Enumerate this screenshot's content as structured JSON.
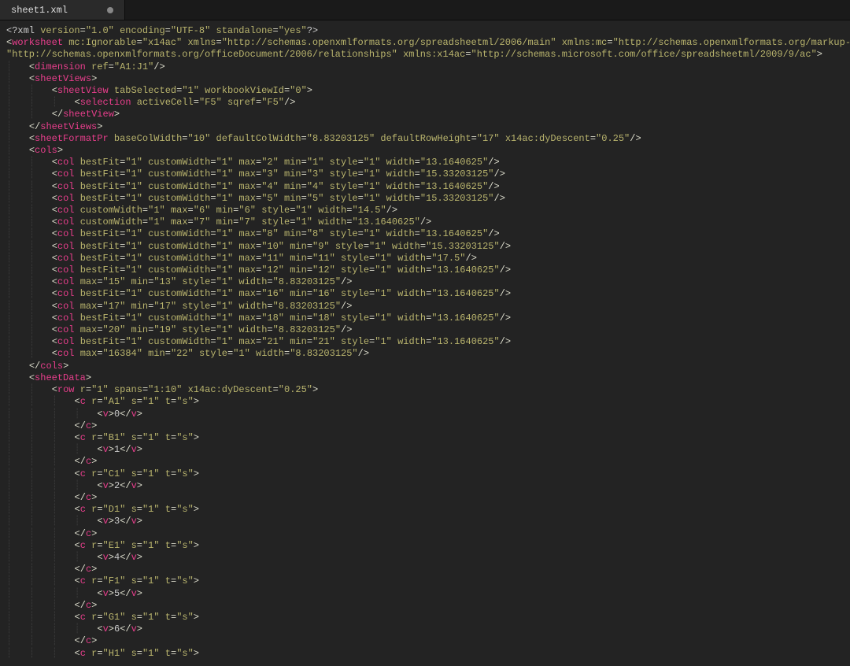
{
  "tab": {
    "filename": "sheet1.xml",
    "dirty": true
  },
  "xml_decl": {
    "version": "1.0",
    "encoding": "UTF-8",
    "standalone": "yes"
  },
  "worksheet": {
    "mc_Ignorable": "x14ac",
    "xmlns": "http://schemas.openxmlformats.org/spreadsheetml/2006/main",
    "xmlns_mc": "http://schemas.openxmlformats.org/markup-co",
    "xmlns_r_prefix": "\"http://schemas.openxmlformats.org/officeDocument/2006/relationships\"",
    "xmlns_x14ac": "http://schemas.microsoft.com/office/spreadsheetml/2009/9/ac"
  },
  "dimension": {
    "ref": "A1:J1"
  },
  "sheetView": {
    "tabSelected": "1",
    "workbookViewId": "0"
  },
  "selection": {
    "activeCell": "F5",
    "sqref": "F5"
  },
  "sheetFormatPr": {
    "baseColWidth": "10",
    "defaultColWidth": "8.83203125",
    "defaultRowHeight": "17",
    "dyDescent": "0.25"
  },
  "cols": [
    {
      "bestFit": "1",
      "customWidth": "1",
      "max": "2",
      "min": "1",
      "style": "1",
      "width": "13.1640625"
    },
    {
      "bestFit": "1",
      "customWidth": "1",
      "max": "3",
      "min": "3",
      "style": "1",
      "width": "15.33203125"
    },
    {
      "bestFit": "1",
      "customWidth": "1",
      "max": "4",
      "min": "4",
      "style": "1",
      "width": "13.1640625"
    },
    {
      "bestFit": "1",
      "customWidth": "1",
      "max": "5",
      "min": "5",
      "style": "1",
      "width": "15.33203125"
    },
    {
      "customWidth": "1",
      "max": "6",
      "min": "6",
      "style": "1",
      "width": "14.5"
    },
    {
      "customWidth": "1",
      "max": "7",
      "min": "7",
      "style": "1",
      "width": "13.1640625"
    },
    {
      "bestFit": "1",
      "customWidth": "1",
      "max": "8",
      "min": "8",
      "style": "1",
      "width": "13.1640625"
    },
    {
      "bestFit": "1",
      "customWidth": "1",
      "max": "10",
      "min": "9",
      "style": "1",
      "width": "15.33203125"
    },
    {
      "bestFit": "1",
      "customWidth": "1",
      "max": "11",
      "min": "11",
      "style": "1",
      "width": "17.5"
    },
    {
      "bestFit": "1",
      "customWidth": "1",
      "max": "12",
      "min": "12",
      "style": "1",
      "width": "13.1640625"
    },
    {
      "max": "15",
      "min": "13",
      "style": "1",
      "width": "8.83203125"
    },
    {
      "bestFit": "1",
      "customWidth": "1",
      "max": "16",
      "min": "16",
      "style": "1",
      "width": "13.1640625"
    },
    {
      "max": "17",
      "min": "17",
      "style": "1",
      "width": "8.83203125"
    },
    {
      "bestFit": "1",
      "customWidth": "1",
      "max": "18",
      "min": "18",
      "style": "1",
      "width": "13.1640625"
    },
    {
      "max": "20",
      "min": "19",
      "style": "1",
      "width": "8.83203125"
    },
    {
      "bestFit": "1",
      "customWidth": "1",
      "max": "21",
      "min": "21",
      "style": "1",
      "width": "13.1640625"
    },
    {
      "max": "16384",
      "min": "22",
      "style": "1",
      "width": "8.83203125"
    }
  ],
  "row": {
    "r": "1",
    "spans": "1:10",
    "dyDescent": "0.25"
  },
  "cells": [
    {
      "r": "A1",
      "s": "1",
      "t": "s",
      "v": "0"
    },
    {
      "r": "B1",
      "s": "1",
      "t": "s",
      "v": "1"
    },
    {
      "r": "C1",
      "s": "1",
      "t": "s",
      "v": "2"
    },
    {
      "r": "D1",
      "s": "1",
      "t": "s",
      "v": "3"
    },
    {
      "r": "E1",
      "s": "1",
      "t": "s",
      "v": "4"
    },
    {
      "r": "F1",
      "s": "1",
      "t": "s",
      "v": "5"
    },
    {
      "r": "G1",
      "s": "1",
      "t": "s",
      "v": "6"
    },
    {
      "r": "H1",
      "s": "1",
      "t": "s"
    }
  ]
}
